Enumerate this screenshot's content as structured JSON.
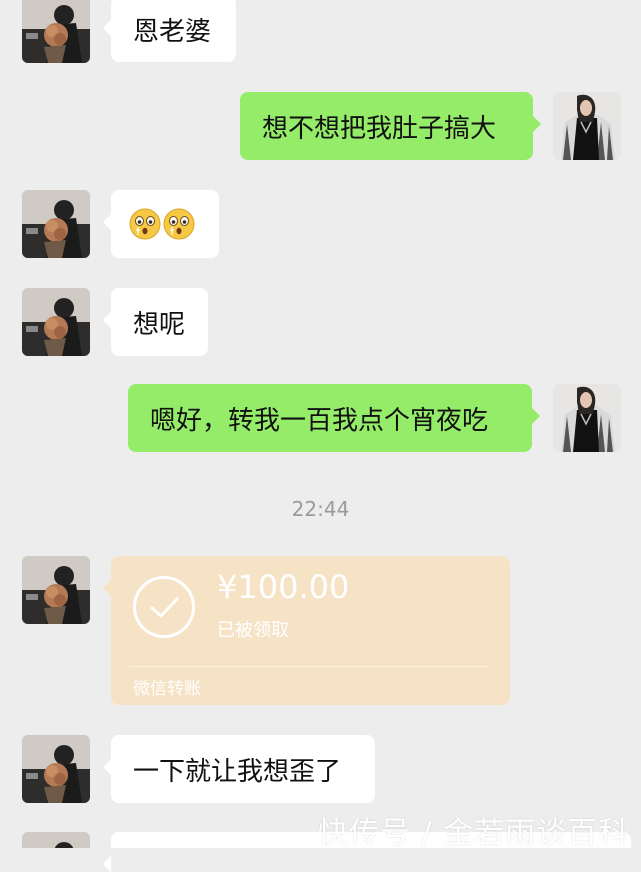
{
  "messages": [
    {
      "side": "in",
      "text": "恩老婆"
    },
    {
      "side": "out",
      "text": "想不想把我肚子搞大"
    },
    {
      "side": "in",
      "emoji": [
        "surprised-face",
        "surprised-face"
      ]
    },
    {
      "side": "in",
      "text": "想呢"
    },
    {
      "side": "out",
      "text": "嗯好，转我一百我点个宵夜吃"
    },
    {
      "side": "in",
      "text": "一下就让我想歪了"
    }
  ],
  "timestamp": "22:44",
  "transfer": {
    "amount": "¥100.00",
    "status": "已被领取",
    "label": "微信转账"
  },
  "watermark": "快传号 / 金若雨谈百科",
  "colors": {
    "background": "#ededed",
    "incoming_bubble": "#ffffff",
    "outgoing_bubble": "#95ec69",
    "transfer_card": "#f6e3c6",
    "timestamp": "#9a9a9a"
  }
}
